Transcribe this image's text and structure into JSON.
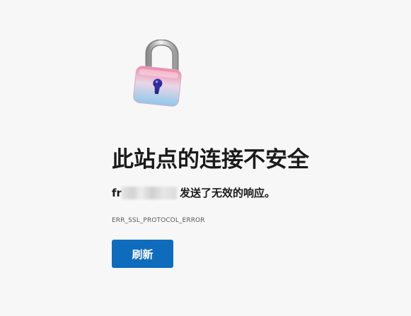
{
  "error_page": {
    "title": "此站点的连接不安全",
    "domain_prefix": "fr",
    "message_suffix": "发送了无效的响应。",
    "error_code": "ERR_SSL_PROTOCOL_ERROR",
    "reload_label": "刷新"
  },
  "icons": {
    "lock": "unlocked-padlock-icon"
  },
  "colors": {
    "background": "#f7f7f7",
    "button": "#0f6cbd",
    "button_text": "#ffffff",
    "title_text": "#1b1b1b"
  }
}
